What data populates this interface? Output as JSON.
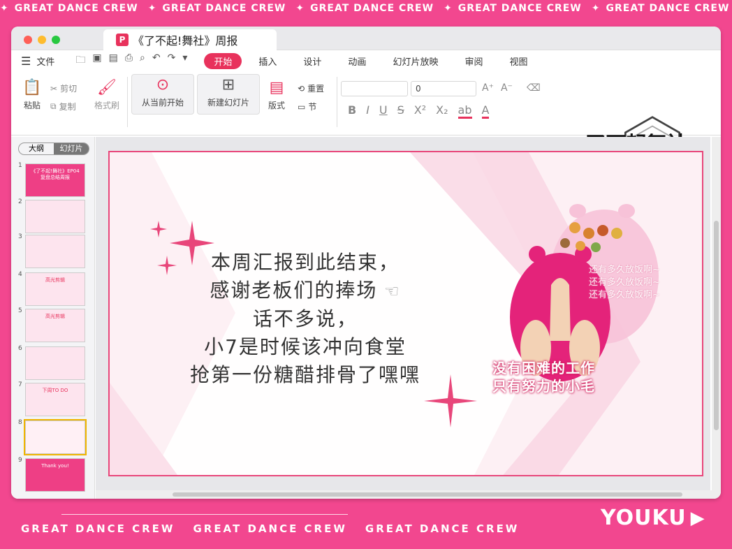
{
  "banner": {
    "text": "GREAT DANCE CREW",
    "repeat": 6
  },
  "window": {
    "tab_title": "《了不起!舞社》周报",
    "tab_logo": "P"
  },
  "menu": {
    "file": "文件",
    "tabs": [
      "开始",
      "插入",
      "设计",
      "动画",
      "幻灯片放映",
      "审阅",
      "视图"
    ],
    "active_tab": "开始"
  },
  "ribbon": {
    "paste": "粘贴",
    "cut": "剪切",
    "copy": "复制",
    "format_painter": "格式刷",
    "play_from_current": "从当前开始",
    "new_slide": "新建幻灯片",
    "layout": "版式",
    "reset": "重置",
    "section": "节",
    "font_size": "0",
    "brand": "了不起舞社"
  },
  "sidebar": {
    "outline_tab": "大纲",
    "slides_tab": "幻灯片",
    "slide_numbers": [
      "1",
      "2",
      "3",
      "4",
      "5",
      "6",
      "7",
      "8",
      "9"
    ],
    "selected": 8,
    "thumb_titles": [
      "《了不起!舞社》EP04复盘总结周报",
      "",
      "",
      "高光剪辑",
      "高光剪辑",
      "",
      "下周TO DO",
      "",
      "Thank you!"
    ]
  },
  "slide": {
    "lines": [
      "本周汇报到此结束，",
      "感谢老板们的捧场",
      "话不多说，",
      "小7是时候该冲向食堂",
      "抢第一份糖醋排骨了嘿嘿"
    ],
    "caption_lines": [
      "没有困难的工作",
      "只有努力的小毛"
    ],
    "ghost_lines": [
      "还有多久放饭啊~",
      "还有多久放饭啊~",
      "还有多久放饭啊~"
    ]
  },
  "footer": {
    "crew": [
      "GREAT DANCE CREW",
      "GREAT DANCE CREW",
      "GREAT DANCE CREW"
    ],
    "logo": "YOUKU"
  },
  "colors": {
    "brand_pink": "#f2478f",
    "accent_red": "#e8325c",
    "slide_border": "#e8467a"
  }
}
